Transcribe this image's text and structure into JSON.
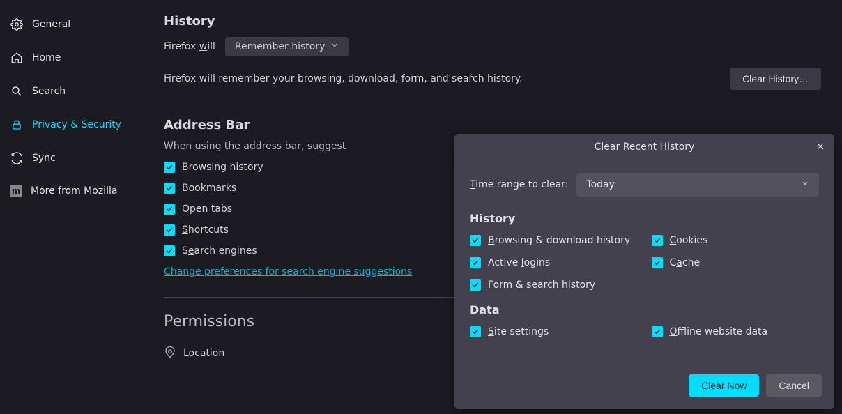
{
  "sidebar": {
    "items": [
      {
        "label": "General"
      },
      {
        "label": "Home"
      },
      {
        "label": "Search"
      },
      {
        "label": "Privacy & Security"
      },
      {
        "label": "Sync"
      },
      {
        "label": "More from Mozilla"
      }
    ]
  },
  "history_section": {
    "title": "History",
    "will_label": "Firefox will",
    "mode": "Remember history",
    "description": "Firefox will remember your browsing, download, form, and search history.",
    "clear_btn": "Clear History…"
  },
  "addressbar": {
    "title": "Address Bar",
    "subtitle": "When using the address bar, suggest",
    "items": [
      "Browsing history",
      "Bookmarks",
      "Open tabs",
      "Shortcuts",
      "Search engines"
    ],
    "link": "Change preferences for search engine suggestions"
  },
  "permissions": {
    "title": "Permissions",
    "location": "Location"
  },
  "dialog": {
    "title": "Clear Recent History",
    "time_label": "Time range to clear:",
    "time_value": "Today",
    "history_title": "History",
    "left": [
      "Browsing & download history",
      "Active logins",
      "Form & search history"
    ],
    "right": [
      "Cookies",
      "Cache"
    ],
    "data_title": "Data",
    "data_left": "Site settings",
    "data_right": "Offline website data",
    "clear_btn": "Clear Now",
    "cancel_btn": "Cancel"
  }
}
